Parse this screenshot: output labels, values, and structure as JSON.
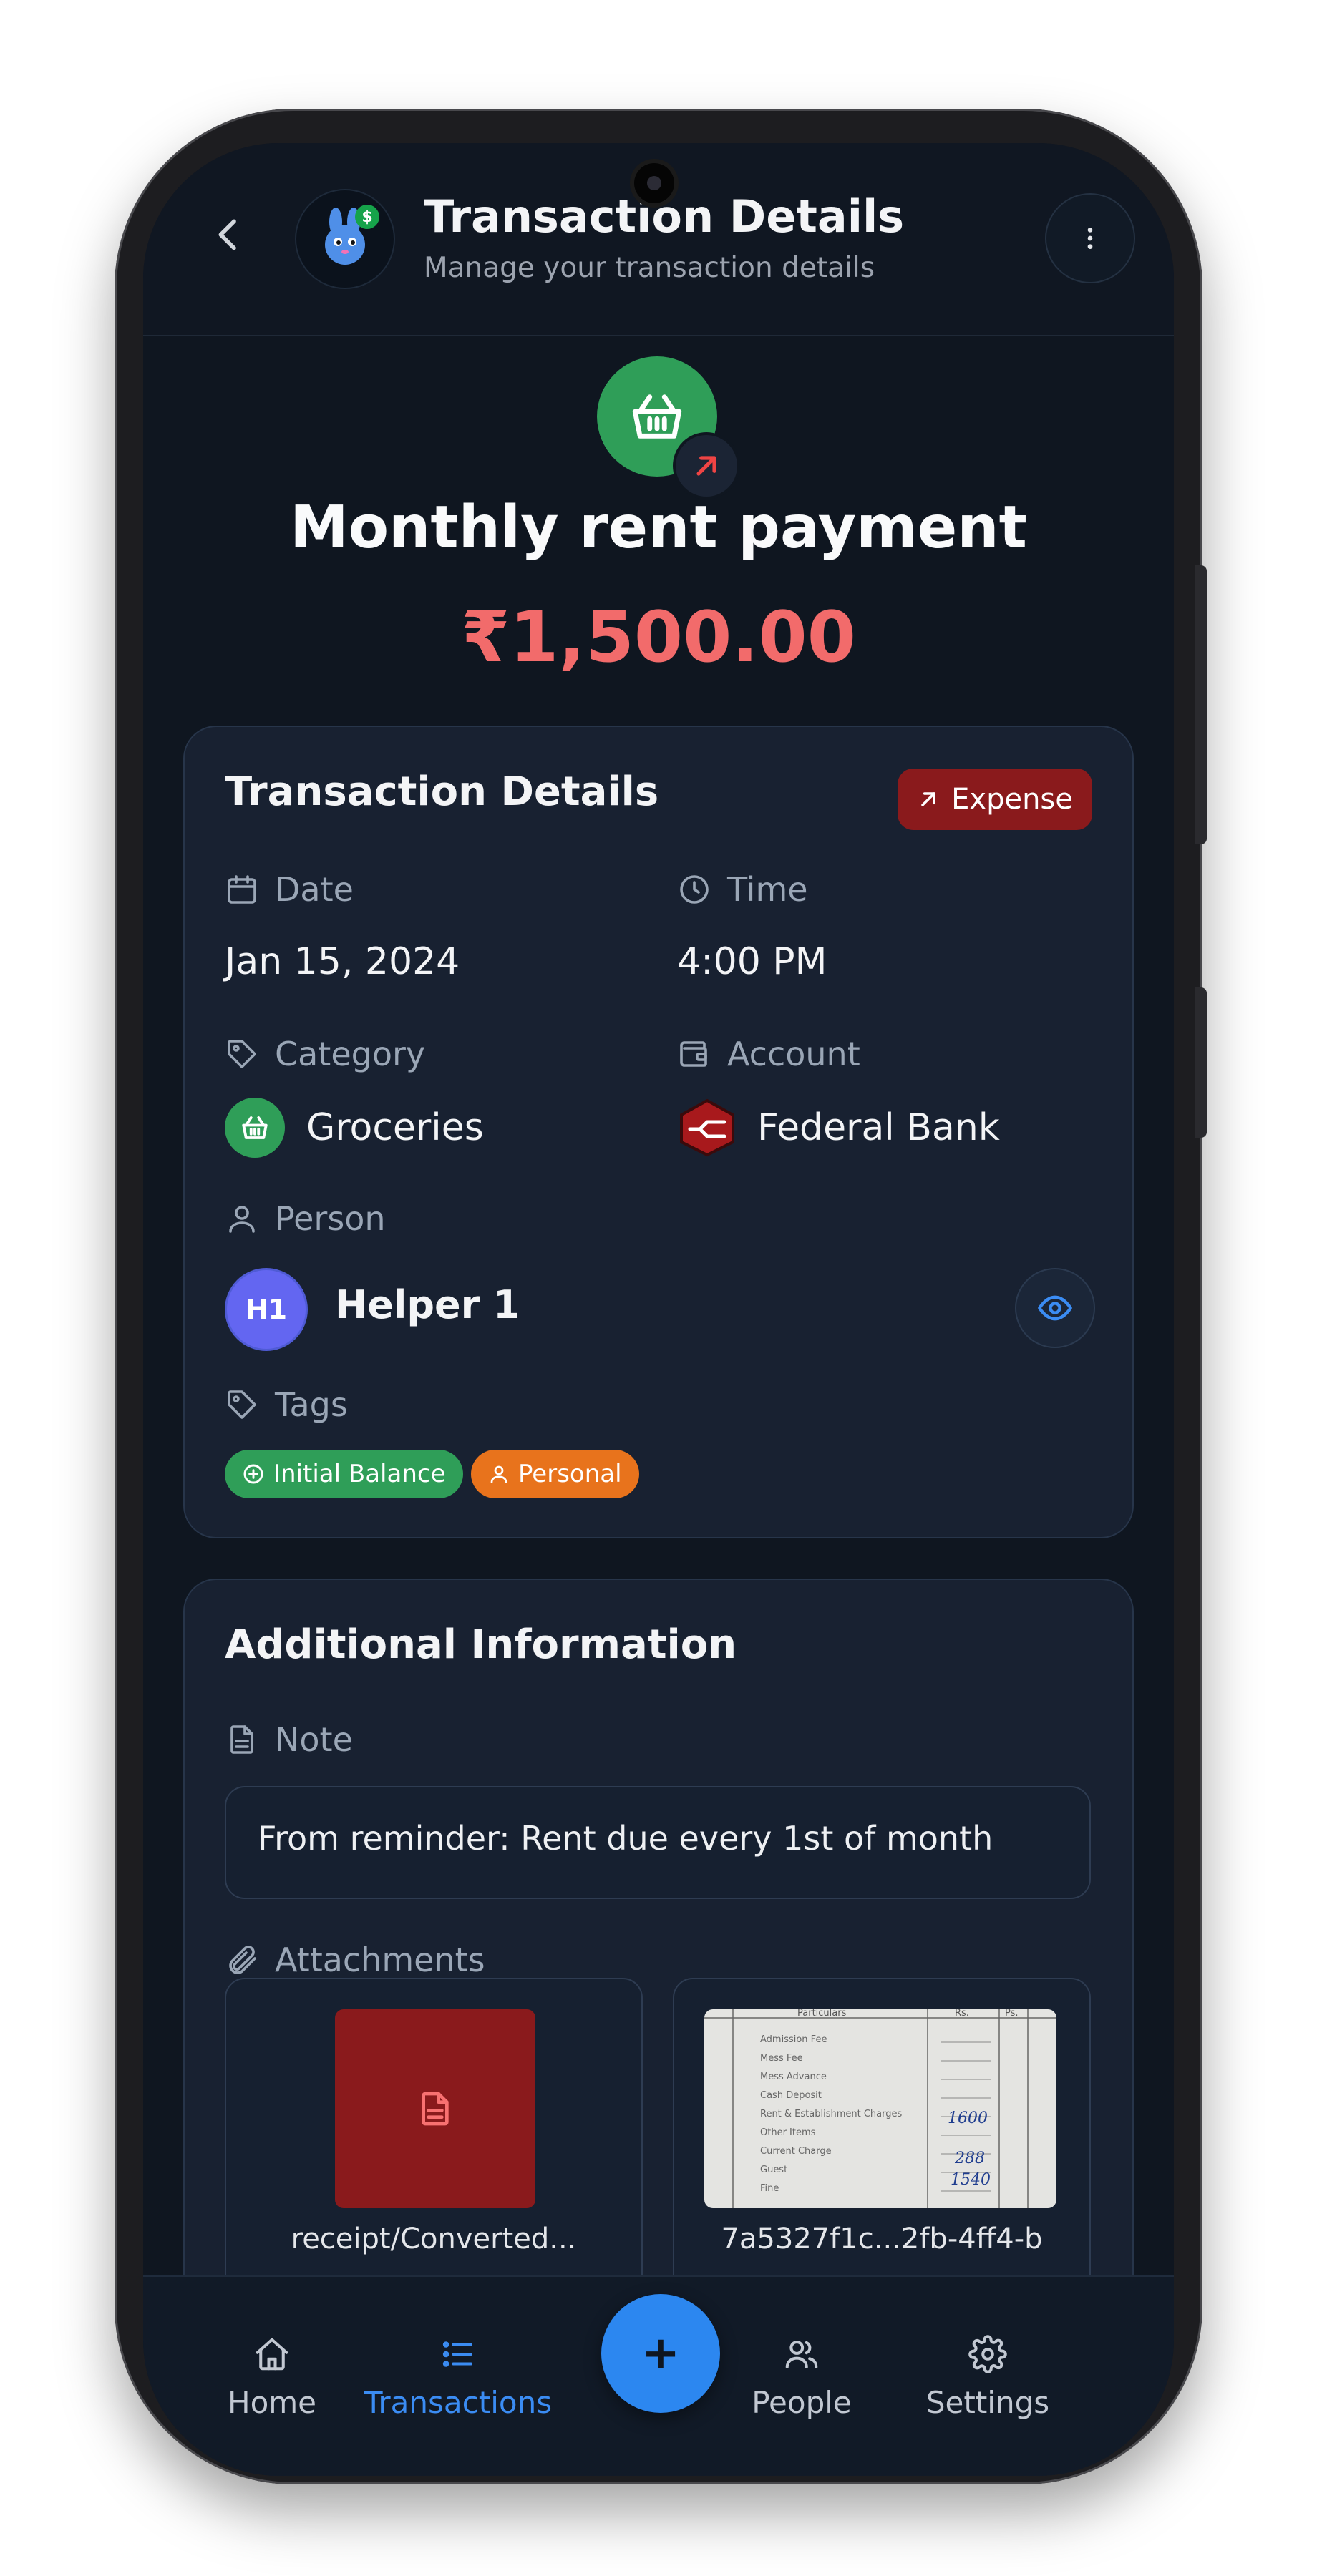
{
  "header": {
    "title": "Transaction Details",
    "subtitle": "Manage your transaction details",
    "logo_coin": "$"
  },
  "transaction": {
    "title": "Monthly rent payment",
    "amount": "₹1,500.00",
    "category_icon": "basket-icon",
    "direction_icon": "arrow-up-right-icon"
  },
  "details_card": {
    "title": "Transaction Details",
    "type_badge": "Expense",
    "date_label": "Date",
    "date_value": "Jan 15, 2024",
    "time_label": "Time",
    "time_value": "4:00 PM",
    "category_label": "Category",
    "category_value": "Groceries",
    "account_label": "Account",
    "account_value": "Federal Bank",
    "person_label": "Person",
    "person_initials": "H1",
    "person_name": "Helper 1",
    "tags_label": "Tags",
    "tags": [
      {
        "label": "Initial Balance",
        "color": "#2f9e58",
        "icon": "plus-circle-icon"
      },
      {
        "label": "Personal",
        "color": "#e8731c",
        "icon": "user-icon"
      }
    ]
  },
  "additional_card": {
    "title": "Additional Information",
    "note_label": "Note",
    "note_value": "From reminder: Rent due every 1st of month",
    "attachments_label": "Attachments",
    "attachments": [
      {
        "name": "receipt/Converted...",
        "type": "document"
      },
      {
        "name": "7a5327f1c...2fb-4ff4-b",
        "type": "image"
      }
    ]
  },
  "receipt_sheet": {
    "header": "Particulars",
    "col_rs": "Rs.",
    "col_ps": "Ps.",
    "rows": [
      "Admission Fee",
      "Mess Fee",
      "Mess Advance",
      "Cash Deposit",
      "Rent & Establishment Charges",
      "Other Items",
      "Current Charge",
      "Guest",
      "Fine"
    ],
    "amounts": [
      "1600",
      "288",
      "1540"
    ]
  },
  "nav": {
    "home": "Home",
    "transactions": "Transactions",
    "people": "People",
    "settings": "Settings",
    "fab": "+"
  },
  "colors": {
    "expense": "#f26b6b",
    "accent": "#2c87f0",
    "expense_badge": "#8a1a1c",
    "category": "#2f9e58"
  }
}
